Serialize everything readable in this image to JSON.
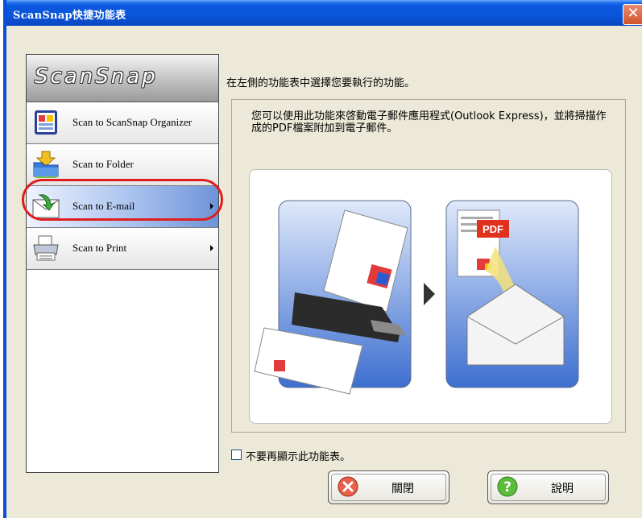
{
  "window": {
    "title": "ScanSnap快捷功能表",
    "close_glyph": "✕"
  },
  "sidebar": {
    "logo_text": "ScanSnap",
    "items": [
      {
        "label": "Scan to ScanSnap Organizer",
        "icon": "organizer-icon",
        "selected": false,
        "has_arrow": false
      },
      {
        "label": "Scan to Folder",
        "icon": "folder-icon",
        "selected": false,
        "has_arrow": false
      },
      {
        "label": "Scan to E-mail",
        "icon": "email-icon",
        "selected": true,
        "has_arrow": true
      },
      {
        "label": "Scan to Print",
        "icon": "printer-icon",
        "selected": false,
        "has_arrow": true
      }
    ]
  },
  "main": {
    "instruction": "在左側的功能表中選擇您要執行的功能。",
    "description": "您可以使用此功能來啓動電子郵件應用程式(Outlook Express)，並將掃描作成的PDF檔案附加到電子郵件。",
    "pdf_badge": "PDF"
  },
  "footer": {
    "checkbox_label": "不要再顯示此功能表。",
    "checkbox_checked": false,
    "close_button": "關閉",
    "help_button": "說明"
  },
  "colors": {
    "titlebar": "#0a55d8",
    "highlight": "#e01e1e",
    "pdf_badge": "#e0301e",
    "selected_item": "#6f93d8"
  }
}
